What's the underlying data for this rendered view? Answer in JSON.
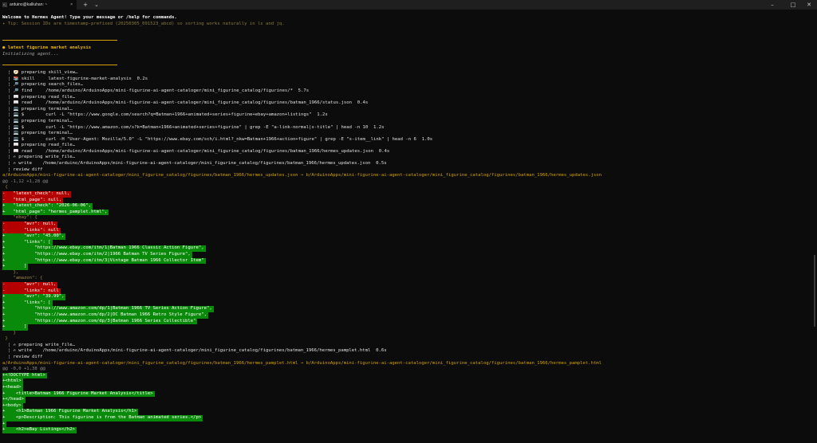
{
  "titlebar": {
    "tab_title": "arduino@kalliuhan: ~",
    "tab_icon": "terminal-icon",
    "close_tab": "×",
    "new_tab": "+",
    "dropdown": "⌄",
    "minimize": "–",
    "maximize": "□",
    "close": "✕"
  },
  "terminal": {
    "welcome": "Welcome to Hermes Agent! Type your message or /help for commands.",
    "tip": "✦ Tip: Session IDs are timestamp-prefixed (20250305_091523_abcd) so sorting works naturally in ls and jq.",
    "prompt": "● latest figurine market analysis",
    "initializing": "Initializing agent...",
    "activity": [
      "  ┊ 🧭 preparing skill_view…",
      "  ┊ 📚 skill     latest-figurine-market-analysis  0.2s",
      "  ┊ 🔎 preparing search_files…",
      "  ┊ 🔎 find     /home/arduino/ArduinoApps/mini-figurine-ai-agent-cataloger/mini_figurine_catalog/figurines/*  5.7s",
      "  ┊ 📖 preparing read_file…",
      "  ┊ 📖 read     /home/arduino/ArduinoApps/mini-figurine-ai-agent-cataloger/mini_figurine_catalog/figurines/batman_1966/status.json  0.4s",
      "  ┊ 💻 preparing terminal…",
      "  ┊ 💻 $        curl -L \"https://www.google.com/search?q=Batman+1966+animated+series+figurine+ebay+amazon+listings\"  1.2s",
      "  ┊ 💻 preparing terminal…",
      "  ┊ 💻 $        curl -L \"https://www.amazon.com/s?k=Batman+1966+animated+series+figurine\" | grep -E \"a-link-normal|s-title\" | head -n 10  1.2s",
      "  ┊ 💻 preparing terminal…",
      "  ┊ 💻 $        curl -H \"User-Agent: Mozilla/5.0\" -L \"https://www.ebay.com/sch/i.html?_nkw=Batman+1966+action+figure\" | grep -E \"s-item__link\" | head -n 6  1.0s",
      "  ┊ 📖 preparing read_file…",
      "  ┊ 📖 read     /home/arduino/ArduinoApps/mini-figurine-ai-agent-cataloger/mini_figurine_catalog/figurines/batman_1966/hermes_updates.json  0.4s",
      "  ┊ ✍ preparing write_file…",
      "  ┊ ✍ write    /home/arduino/ArduinoApps/mini-figurine-ai-agent-cataloger/mini_figurine_catalog/figurines/batman_1966/hermes_updates.json  0.5s",
      "  ┊ review diff"
    ],
    "diff1": {
      "file_header": "a/ArduinoApps/mini-figurine-ai-agent-cataloger/mini_figurine_catalog/figurines/batman_1966/hermes_updates.json → b/ArduinoApps/mini-figurine-ai-agent-cataloger/mini_figurine_catalog/figurines/batman_1966/hermes_updates.json",
      "hunk": "@@ -1,12 +1,28 @@",
      "lines": [
        {
          "t": "ctx",
          "s": " {"
        },
        {
          "t": "del",
          "s": "-   \"latest_check\": null,"
        },
        {
          "t": "del",
          "s": "-   \"html_page\": null,"
        },
        {
          "t": "add",
          "s": "+   \"latest_check\": \"2026-06-06\","
        },
        {
          "t": "add",
          "s": "+   \"html_page\": \"hermes_pamplet.html\","
        },
        {
          "t": "ctx",
          "s": "    \"ebay\": {"
        },
        {
          "t": "del",
          "s": "-       \"avr\": null,"
        },
        {
          "t": "del",
          "s": "-       \"links\": null"
        },
        {
          "t": "add",
          "s": "+       \"avr\": \"45.00\","
        },
        {
          "t": "add",
          "s": "+       \"links\": ["
        },
        {
          "t": "add",
          "s": "+           \"https://www.ebay.com/itm/1|Batman 1966 Classic Action Figure\","
        },
        {
          "t": "add",
          "s": "+           \"https://www.ebay.com/itm/2|1966 Batman TV Series Figure\","
        },
        {
          "t": "add",
          "s": "+           \"https://www.ebay.com/itm/3|Vintage Batman 1966 Collector Item\""
        },
        {
          "t": "add",
          "s": "+       ]"
        },
        {
          "t": "ctx",
          "s": "    },"
        },
        {
          "t": "ctx",
          "s": "    \"amazon\": {"
        },
        {
          "t": "del",
          "s": "-       \"avr\": null,"
        },
        {
          "t": "del",
          "s": "-       \"links\": null"
        },
        {
          "t": "add",
          "s": "+       \"avr\": \"39.99\","
        },
        {
          "t": "add",
          "s": "+       \"links\": ["
        },
        {
          "t": "add",
          "s": "+           \"https://www.amazon.com/dp/1|Batman 1966 TV Series Action Figure\","
        },
        {
          "t": "add",
          "s": "+           \"https://www.amazon.com/dp/2|DC Batman 1966 Retro Style Figure\","
        },
        {
          "t": "add",
          "s": "+           \"https://www.amazon.com/dp/3|Batman 1966 Series Collectible\""
        },
        {
          "t": "add",
          "s": "+       ]"
        },
        {
          "t": "ctx",
          "s": "    }"
        },
        {
          "t": "ctx",
          "s": " }"
        }
      ]
    },
    "activity2": [
      "  ┊ ✍ preparing write_file…",
      "  ┊ ✍ write    /home/arduino/ArduinoApps/mini-figurine-ai-agent-cataloger/mini_figurine_catalog/figurines/batman_1966/hermes_pamplet.html  0.6s",
      "  ┊ review diff"
    ],
    "diff2": {
      "file_header": "a/ArduinoApps/mini-figurine-ai-agent-cataloger/mini_figurine_catalog/figurines/batman_1966/hermes_pamplet.html → b/ArduinoApps/mini-figurine-ai-agent-cataloger/mini_figurine_catalog/figurines/batman_1966/hermes_pamplet.html",
      "hunk": "@@ -0,0 +1,38 @@",
      "lines": [
        {
          "t": "add",
          "s": "+<!DOCTYPE html>"
        },
        {
          "t": "add",
          "s": "+<html>"
        },
        {
          "t": "add",
          "s": "+<head>"
        },
        {
          "t": "add",
          "s": "+    <title>Batman 1966 Figurine Market Analysis</title>"
        },
        {
          "t": "add",
          "s": "+</head>"
        },
        {
          "t": "add",
          "s": "+<body>"
        },
        {
          "t": "add",
          "s": "+    <h1>Batman 1966 Figurine Market Analysis</h1>"
        },
        {
          "t": "add",
          "s": "+    <p>Description: This figurine is from the Batman animated series.</p>"
        },
        {
          "t": "add",
          "s": "+"
        },
        {
          "t": "add",
          "s": "+    <h2>eBay Listings</h2>"
        }
      ]
    }
  },
  "colors": {
    "background": "#0c0c0c",
    "added": "#0a8a0a",
    "removed": "#b50000",
    "accent": "#e8b400"
  }
}
